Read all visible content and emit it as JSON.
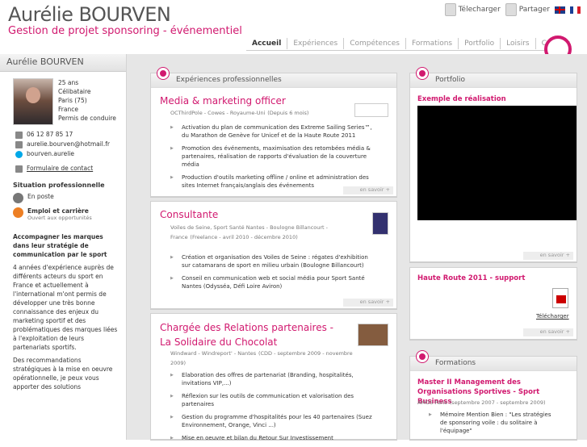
{
  "header": {
    "name": "Aurélie BOURVEN",
    "subtitle": "Gestion de projet sponsoring - événementiel",
    "download_label": "Télecharger",
    "share_label": "Partager",
    "nav": [
      "Accueil",
      "Expériences",
      "Compétences",
      "Formations",
      "Portfolio",
      "Loisirs",
      "Contact"
    ]
  },
  "sidebar": {
    "title": "Aurélie BOURVEN",
    "profile": [
      "25 ans",
      "Célibataire",
      "Paris (75)",
      "France",
      "Permis de conduire"
    ],
    "contacts": [
      "06 12 87 85 17",
      "aurelie.bourven@hotmail.fr",
      "bourven.aurelie",
      "Formulaire de contact"
    ],
    "situation_title": "Situation professionnelle",
    "situation_status": "En poste",
    "career_title": "Emploi et carrière",
    "career_detail": "Ouvert aux opportunités",
    "pitch_title": "Accompagner les marques dans leur stratégie de communication par le sport",
    "pitch_paragraph_1": "4 années d'expérience auprès de différents acteurs du sport en France et actuellement à l'international m'ont permis de développer une très bonne connaissance des enjeux du marketing sportif et des problématiques des marques liées à l'exploitation de leurs partenariats sportifs.",
    "pitch_paragraph_2": "Des recommandations stratégiques à la mise en oeuvre opérationnelle, je peux vous apporter des solutions"
  },
  "experience": {
    "title": "Expériences professionnelles",
    "more_label": "en savoir +",
    "jobs": [
      {
        "title": "Media & marketing officer",
        "company": "OCThirdPole - Cowes - Royaume-Uni",
        "dates": "(Depuis 6 mois)",
        "bullets": [
          "Activation du plan de communication des Extreme Sailing Series™, du Marathon de Genève for Unicef et de la Haute Route 2011",
          "Promotion des événements, maximisation des retombées média & partenaires, réalisation de rapports d'évaluation de la couverture média",
          "Production d'outils marketing offline / online et administration des sites Internet français/anglais des événements"
        ]
      },
      {
        "title": "Consultante",
        "company": "Voiles de Seine, Sport Santé Nantes - Boulogne Billancourt - France",
        "dates": "(Freelance - avril 2010 - décembre 2010)",
        "bullets": [
          "Création et organisation des Voiles de Seine : régates d'exhibition sur catamarans de sport en milieu urbain (Boulogne Billancourt)",
          "Conseil en communication web et social média pour Sport Santé Nantes (Odysséa, Défi Loire Aviron)"
        ]
      },
      {
        "title": "Chargée des Relations partenaires - La Solidaire du Chocolat",
        "company": "Windward - Windreport' - Nantes",
        "dates": "(CDD - septembre 2009 - novembre 2009)",
        "bullets": [
          "Elaboration des offres de partenariat (Branding, hospitalités, invitations VIP,...)",
          "Réflexion sur les outils de communication et valorisation des partenaires",
          "Gestion du programme d'hospitalités pour les 40 partenaires (Suez Environnement, Orange, Vinci ...)",
          "Mise en oeuvre et bilan du Retour Sur Investissement"
        ]
      }
    ]
  },
  "portfolio": {
    "title": "Portfolio",
    "item_1": "Exemple de réalisation",
    "more_label": "en savoir +",
    "item_2": "Haute Route 2011 - support",
    "download": "Télécharger"
  },
  "training": {
    "title": "Formations",
    "degree": "Master II Management des Organisations Sportives - Sport Business",
    "school": "AMOS Paris",
    "dates": "(septembre 2007 - septembre 2009)",
    "note": "Mémoire Mention Bien : \"Les stratégies de sponsoring voile : du solitaire à l'équipage\""
  },
  "colors": {
    "accent": "#d1196f",
    "background": "#e6e6e6"
  }
}
